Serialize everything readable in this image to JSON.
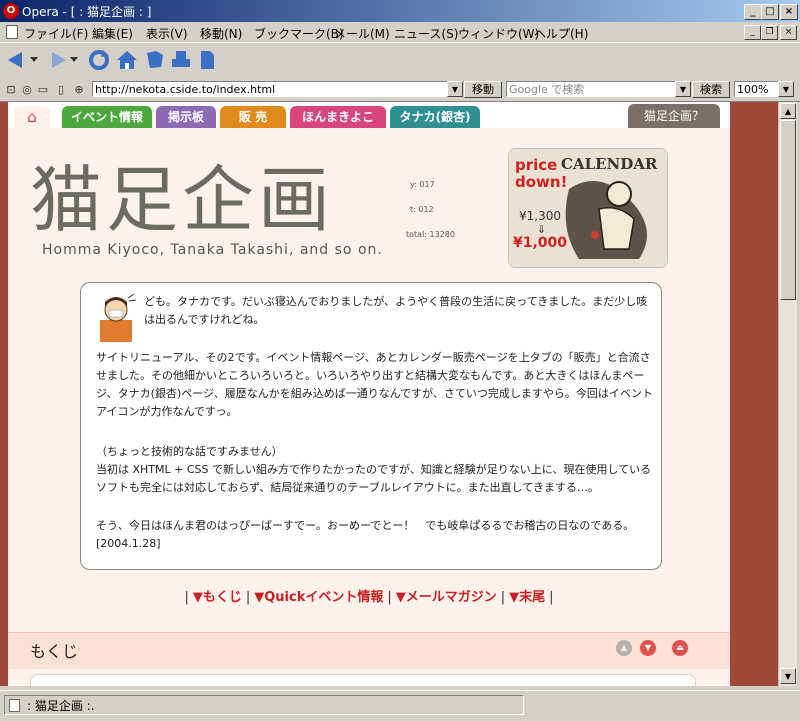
{
  "window": {
    "title": "Opera - [ : 猫足企画 : ]"
  },
  "menu": {
    "items": [
      "ファイル(F)",
      "編集(E)",
      "表示(V)",
      "移動(N)",
      "ブックマーク(B)",
      "メール(M)",
      "ニュース(S)",
      "ウィンドウ(W)",
      "ヘルプ(H)"
    ]
  },
  "toolbar": {
    "icons": [
      "back-icon",
      "dropdown-icon",
      "forward-icon",
      "dropdown-icon",
      "reload-icon",
      "home-icon",
      "hotlist-icon",
      "print-icon",
      "page-icon"
    ]
  },
  "address": {
    "url": "http://nekota.cside.to/index.html",
    "go_label": "移動",
    "search_placeholder": "Google で検索",
    "search_label": "検索",
    "zoom": "100%"
  },
  "page": {
    "tabs": [
      {
        "label": "イベント情報",
        "color": "#4aa83c"
      },
      {
        "label": "掲示板",
        "color": "#8c6ab4"
      },
      {
        "label": "販 売",
        "color": "#e08a1c"
      },
      {
        "label": "ほんまきよこ",
        "color": "#d8447c"
      },
      {
        "label": "タナカ(銀杏)",
        "color": "#2e9090"
      }
    ],
    "right_tab": "猫足企画？",
    "logo_title": "猫足企画",
    "logo_subtitle": "Homma Kiyoco, Tanaka Takashi, and so on.",
    "counters": {
      "today": "y: 017",
      "yesterday": "t: 012",
      "total": "total: 13280"
    },
    "banner": {
      "title": "CALENDAR",
      "tag": "price down!",
      "old_price": "¥1,300",
      "arrow": "⇓",
      "new_price": "¥1,000"
    },
    "message": {
      "p1": "ども。タナカです。だいぶ寝込んでおりましたが、ようやく普段の生活に戻ってきました。まだ少し咳は出るんですけれどね。",
      "p2": "サイトリニューアル、その2です。イベント情報ページ、あとカレンダー販売ページを上タブの「販売」と合流させました。その他細かいところいろいろと。いろいろやり出すと結構大変なもんです。あと大きくはほんまページ、タナカ(銀杏)ページ、履歴なんかを組み込めば一通りなんですが、さていつ完成しますやら。今回はイベントアイコンが力作なんですっ。",
      "p3a": "（ちょっと技術的な話ですみません）",
      "p3b": "当初は XHTML + CSS で新しい組み方で作りたかったのですが、知識と経験が足りない上に、現在使用しているソフトも完全には対応しておらず、結局従来通りのテーブルレイアウトに。また出直してきまする…。",
      "p4": "そう、今日はほんま君のはっぴーばーすでー。おーめーでとー！　でも岐阜ぱるるでお稽古の日なのである。[2004.1.28]"
    },
    "nav_links": [
      "▼もくじ",
      "▼Quickイベント情報",
      "▼メールマガジン",
      "▼末尾"
    ],
    "section_title": "もくじ"
  },
  "status": {
    "text": ": 猫足企画 :."
  }
}
